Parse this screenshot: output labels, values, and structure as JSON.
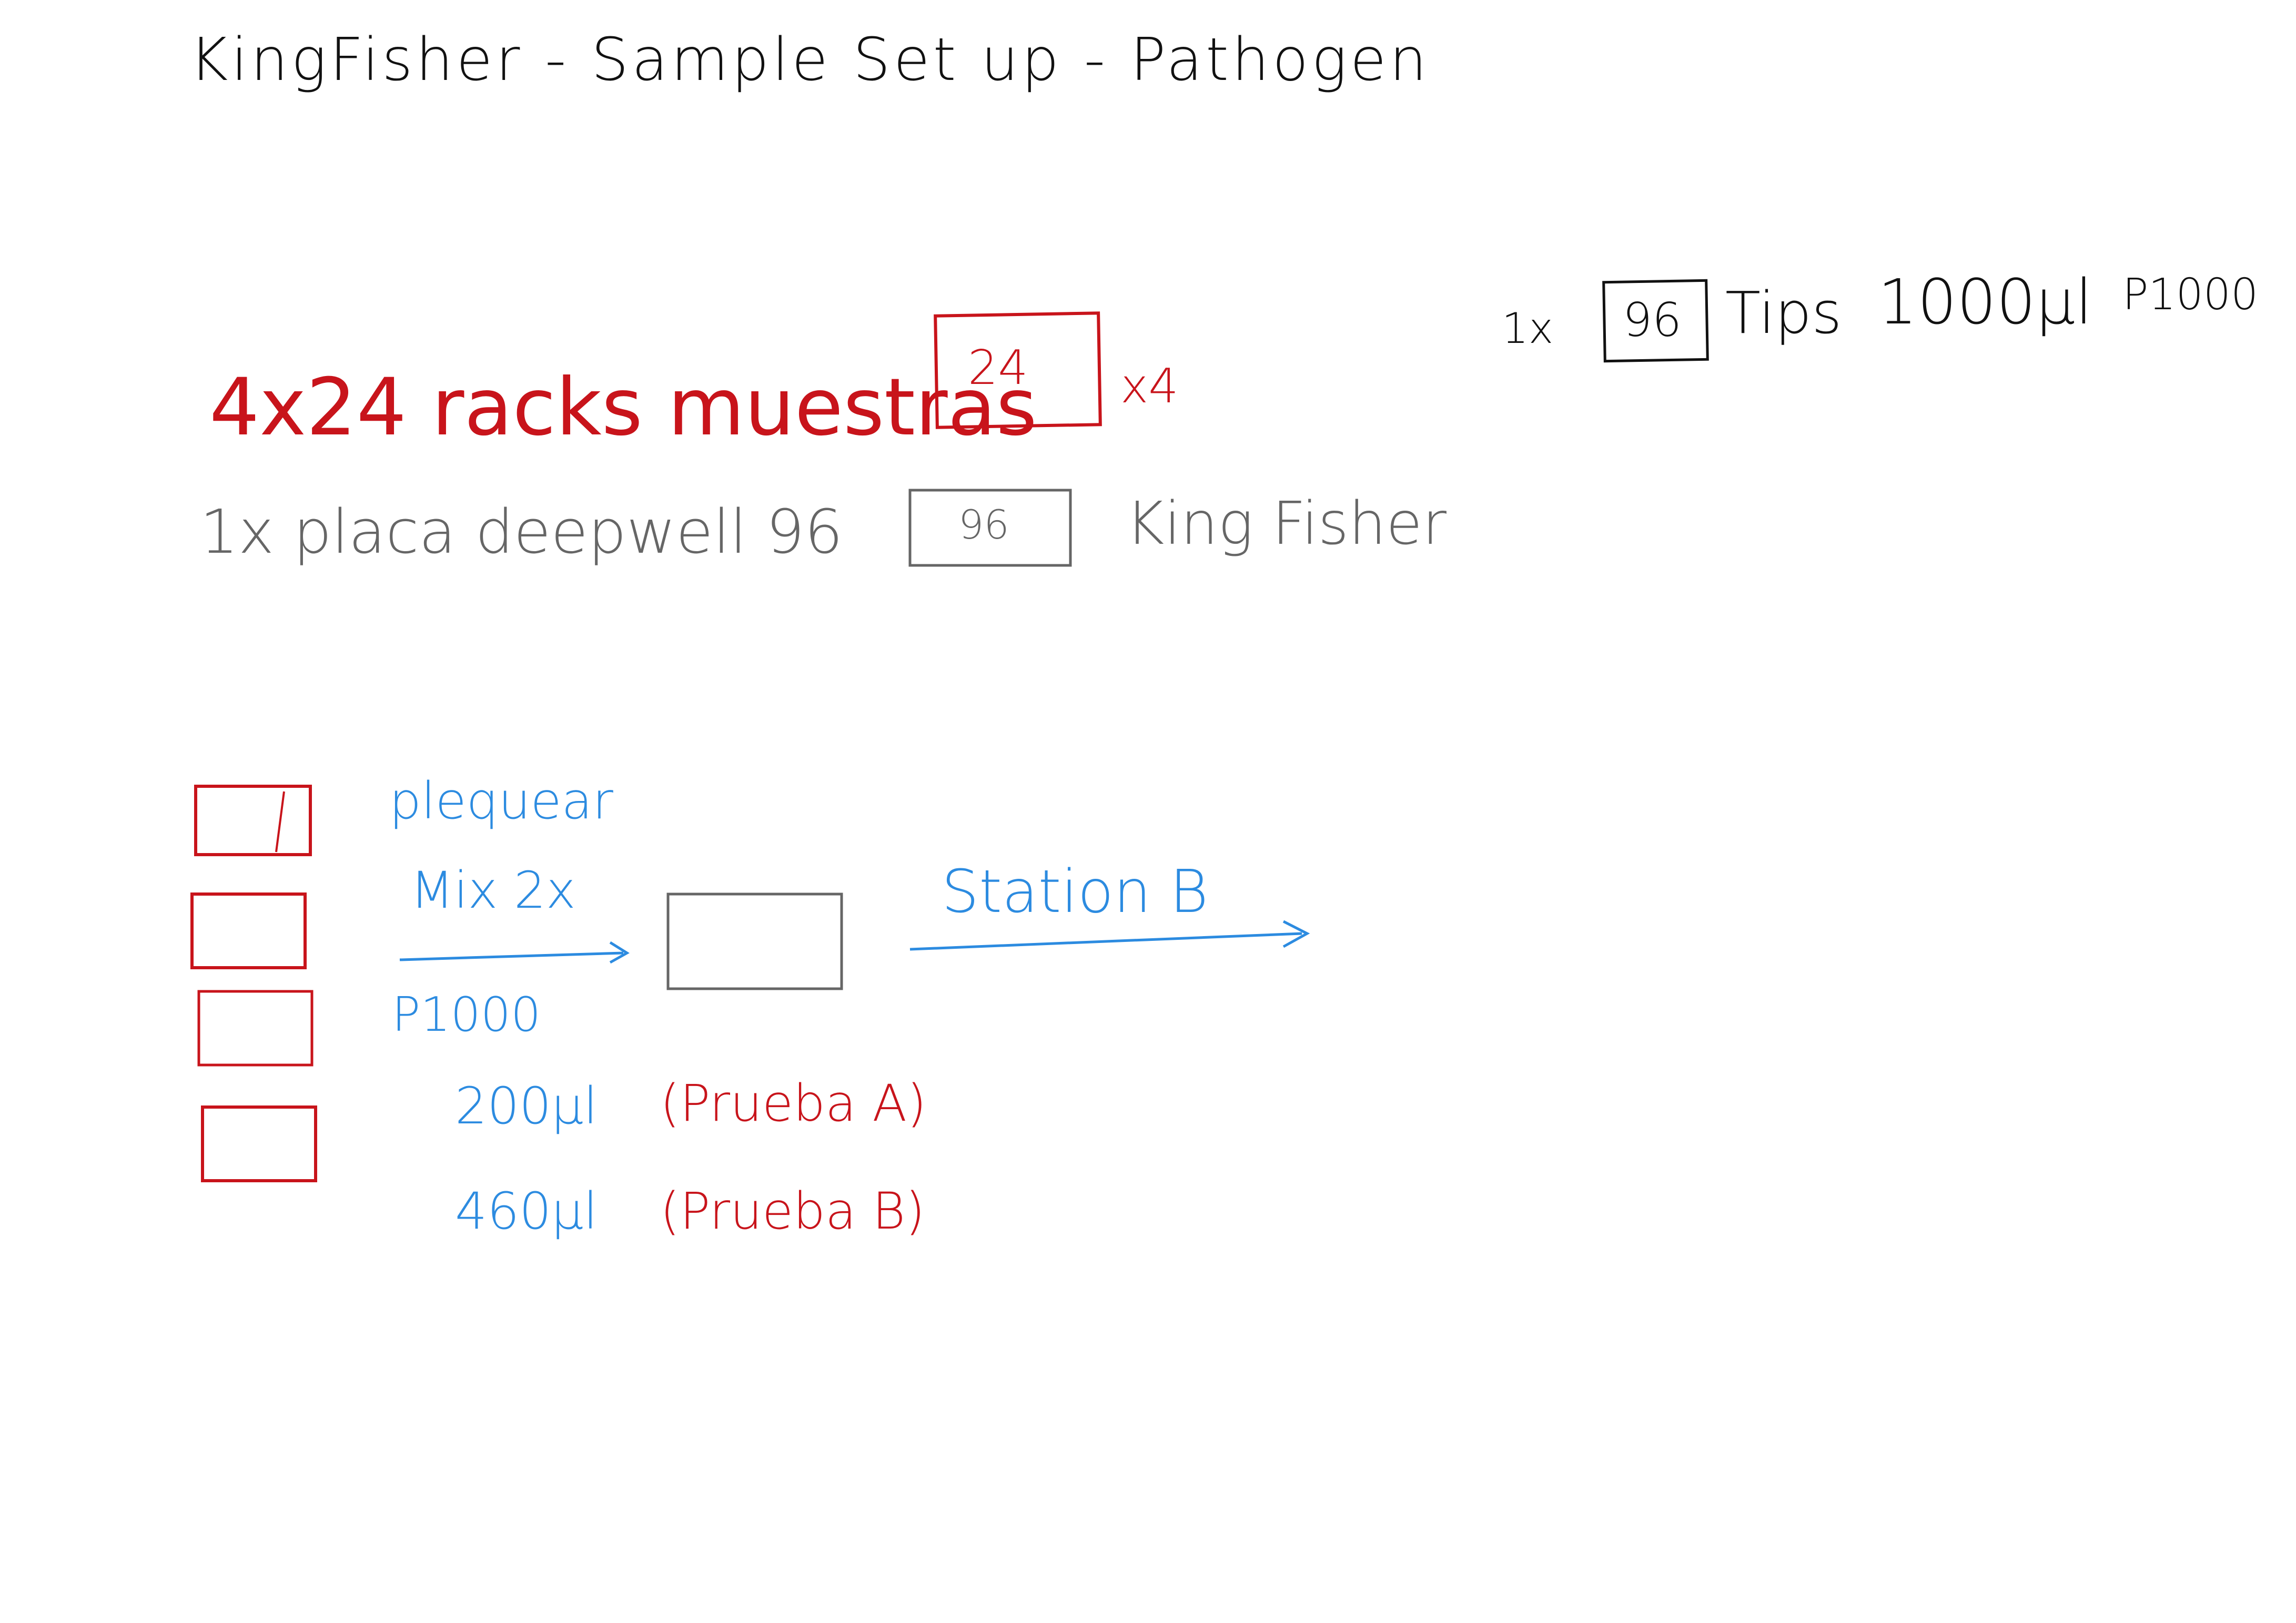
{
  "colors": {
    "black": "#111111",
    "red": "#c8141b",
    "grey": "#666666",
    "blue": "#2c8be0"
  },
  "title": "KingFisher - Sample Set up - Pathogen",
  "tips": {
    "count": "1x",
    "box_label": "96",
    "text": "Tips",
    "volume": "1000µl",
    "pipette": "P1000"
  },
  "racks": {
    "text": "4x24 racks muestras",
    "box_label": "24",
    "multiplier": "x4"
  },
  "plate": {
    "text": "1x placa deepwell 96",
    "box_label": "96",
    "target": "King Fisher"
  },
  "flow": {
    "action": "plequear",
    "mix": "Mix 2x",
    "pipette": "P1000",
    "station": "Station B",
    "volume_a": "200µl",
    "label_a": "(Prueba A)",
    "volume_b": "460µl",
    "label_b": "(Prueba B)"
  }
}
